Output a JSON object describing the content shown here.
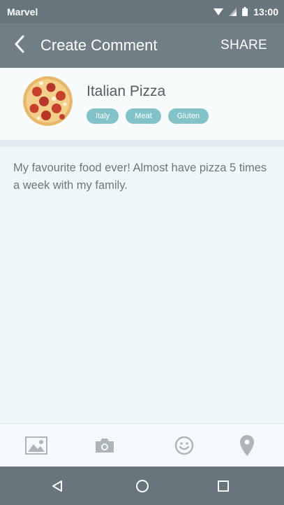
{
  "status_bar": {
    "carrier": "Marvel",
    "time": "13:00",
    "icons": [
      "wifi-icon",
      "signal-icon",
      "battery-icon"
    ]
  },
  "app_bar": {
    "back_icon": "back-arrow-icon",
    "title": "Create Comment",
    "share_label": "SHARE"
  },
  "food": {
    "name": "Italian Pizza",
    "image": "pizza-image",
    "tags": [
      "Italy",
      "Meat",
      "Gluten"
    ]
  },
  "comment": {
    "text": "My favourite food ever! Almost have pizza 5 times a week with my family."
  },
  "toolbar": {
    "items": [
      "image-icon",
      "camera-icon",
      "emoji-icon",
      "location-icon"
    ]
  },
  "nav_bar": {
    "items": [
      "back-triangle-icon",
      "home-circle-icon",
      "recents-square-icon"
    ]
  },
  "colors": {
    "app_bar": "#707f86",
    "status_bar": "#67767d",
    "tag": "#82c2c9",
    "background": "#f0f7fa"
  }
}
